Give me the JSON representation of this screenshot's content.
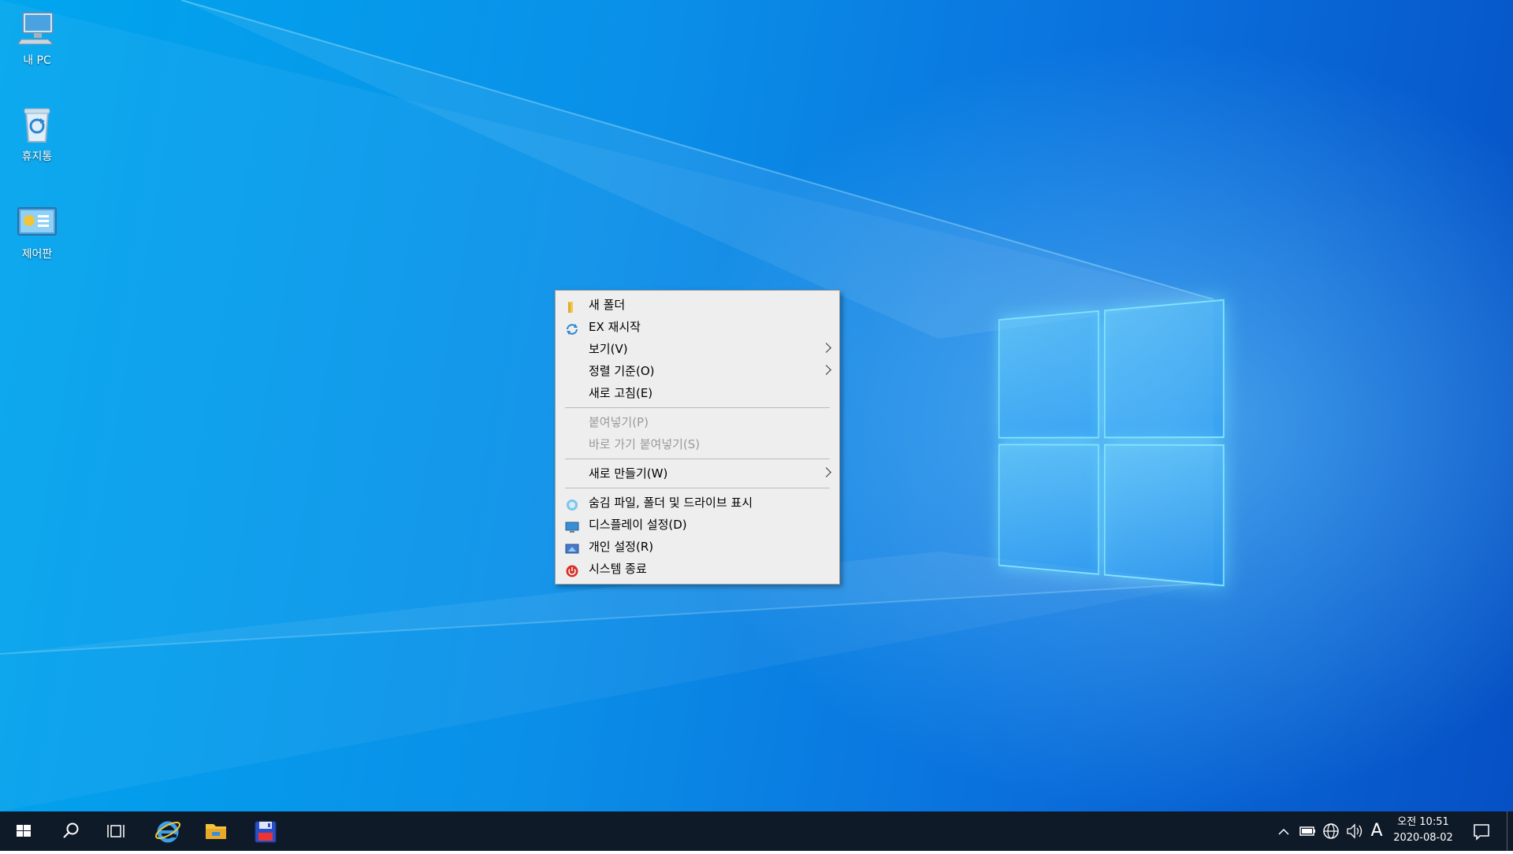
{
  "desktop": {
    "icons": [
      {
        "label": "내 PC",
        "icon": "computer-icon"
      },
      {
        "label": "휴지통",
        "icon": "recycle-bin-icon"
      },
      {
        "label": "제어판",
        "icon": "control-panel-icon"
      }
    ]
  },
  "context_menu": {
    "items": [
      {
        "label": "새 폴더",
        "icon": "folder-icon"
      },
      {
        "label": "EX 재시작",
        "icon": "refresh-icon"
      },
      {
        "label": "보기(V)",
        "submenu": true
      },
      {
        "label": "정렬 기준(O)",
        "submenu": true
      },
      {
        "label": "새로 고침(E)"
      },
      {
        "label": "붙여넣기(P)",
        "disabled": true
      },
      {
        "label": "바로 가기 붙여넣기(S)",
        "disabled": true
      },
      {
        "label": "새로 만들기(W)",
        "submenu": true
      },
      {
        "label": "숨김 파일, 폴더 및 드라이브 표시",
        "icon": "hidden-files-icon"
      },
      {
        "label": "디스플레이 설정(D)",
        "icon": "display-icon"
      },
      {
        "label": "개인 설정(R)",
        "icon": "personalize-icon"
      },
      {
        "label": "시스템 종료",
        "icon": "power-icon"
      }
    ]
  },
  "taskbar": {
    "buttons": [
      "windows-start-icon",
      "search-icon",
      "task-view-icon",
      "internet-explorer-icon",
      "file-explorer-icon",
      "save-floppy-icon"
    ],
    "tray": {
      "input_indicator": "A",
      "time": "오전 10:51",
      "date": "2020-08-02"
    }
  },
  "colors": {
    "taskbar": "#0f1a28",
    "menu_bg": "#eeeeee",
    "desktop_accent": "#0a8fe8"
  }
}
